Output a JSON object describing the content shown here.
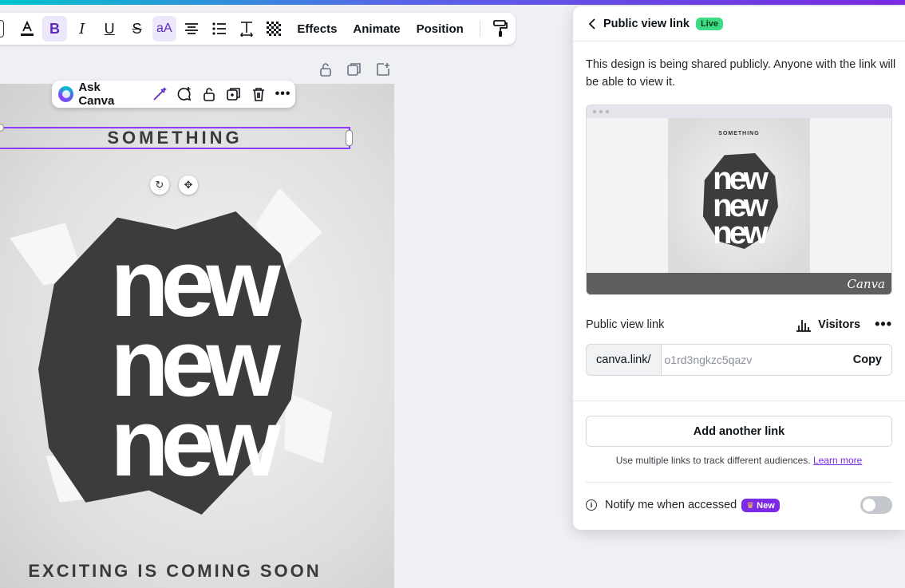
{
  "toolbar": {
    "items": [
      {
        "name": "text-color-button",
        "glyph": "A"
      },
      {
        "name": "bold-button",
        "glyph": "B",
        "active": true
      },
      {
        "name": "italic-button",
        "glyph": "I"
      },
      {
        "name": "underline-button",
        "glyph": "U"
      },
      {
        "name": "strikethrough-button",
        "glyph": "S"
      },
      {
        "name": "letter-case-button",
        "glyph": "aA",
        "active": true
      }
    ],
    "effects_label": "Effects",
    "animate_label": "Animate",
    "position_label": "Position"
  },
  "context_bar": {
    "ask_label": "Ask Canva"
  },
  "design": {
    "title": "SOMETHING",
    "big_word": "new",
    "footer": "EXCITING IS COMING SOON"
  },
  "panel": {
    "title": "Public view link",
    "status_badge": "Live",
    "description": "This design is being shared publicly. Anyone with the link will be able to view it.",
    "preview": {
      "title": "SOMETHING",
      "word": "new",
      "brand": "Canva"
    },
    "link_section_label": "Public view link",
    "visitors_label": "Visitors",
    "link_prefix": "canva.link/",
    "link_value": "o1rd3ngkzc5qazv",
    "copy_label": "Copy",
    "add_link_label": "Add another link",
    "helper_text": "Use multiple links to track different audiences.",
    "learn_more_label": "Learn more",
    "notify_label": "Notify me when accessed",
    "new_badge": "New",
    "notify_enabled": false
  },
  "colors": {
    "accent": "#8b3dff",
    "live": "#3ddc84",
    "new_badge": "#7d2ae8"
  }
}
